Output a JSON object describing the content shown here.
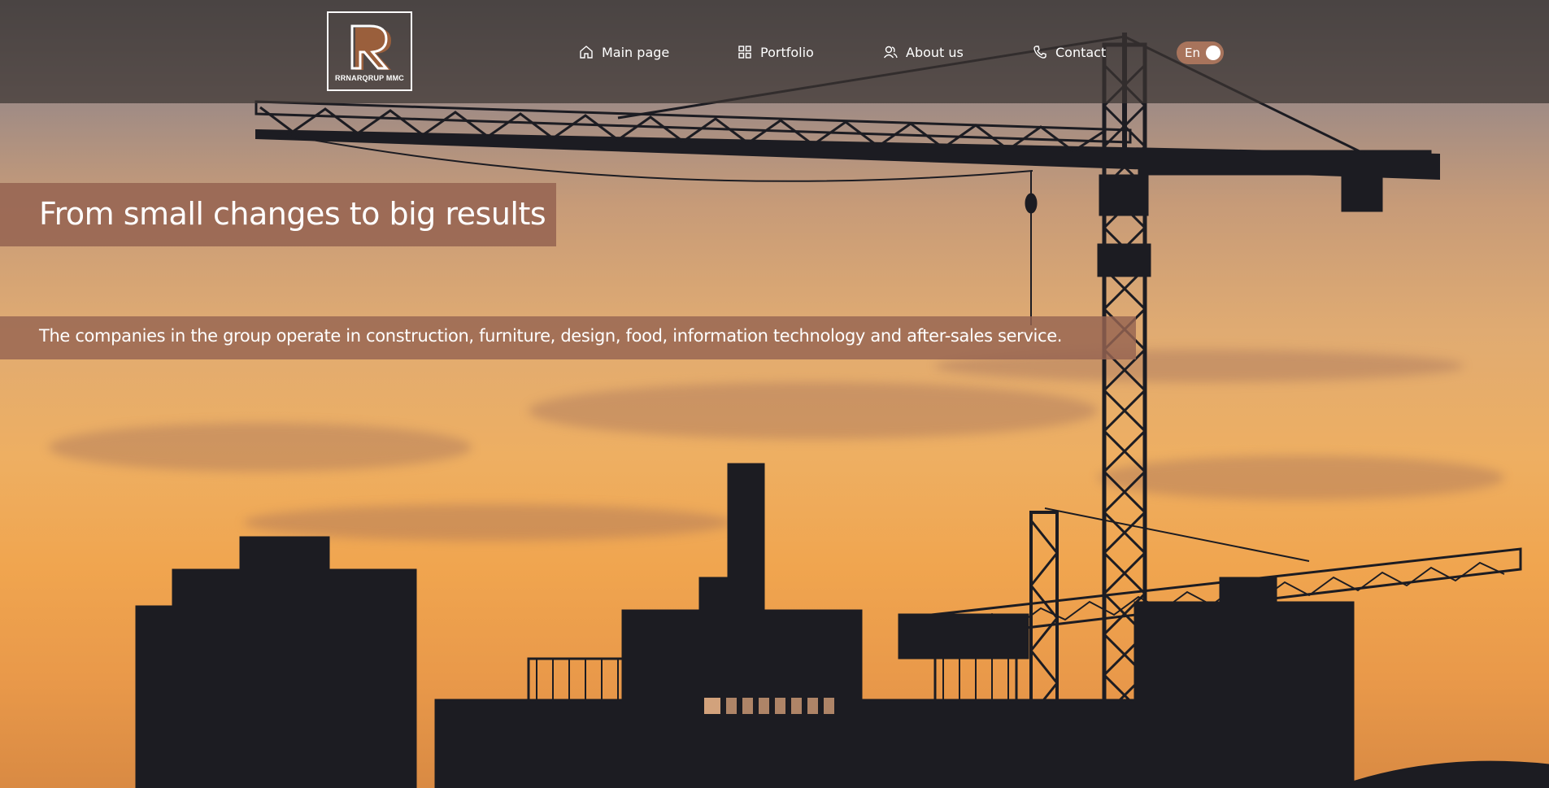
{
  "header": {
    "logo_text": "RRNARQRUP MMC",
    "nav": [
      {
        "label": "Main page",
        "icon": "home-icon"
      },
      {
        "label": "Portfolio",
        "icon": "grid-icon"
      },
      {
        "label": "About us",
        "icon": "users-icon"
      },
      {
        "label": "Contact",
        "icon": "phone-icon"
      }
    ],
    "language_toggle": {
      "label": "En"
    }
  },
  "hero": {
    "title": "From small changes to big results",
    "subtitle": "The companies in the group operate in construction, furniture, design, food, information technology and after-sales service.",
    "slides_total": 8,
    "active_slide": 1
  },
  "colors": {
    "accent": "#9a6650",
    "overlay": "#3c3432"
  }
}
